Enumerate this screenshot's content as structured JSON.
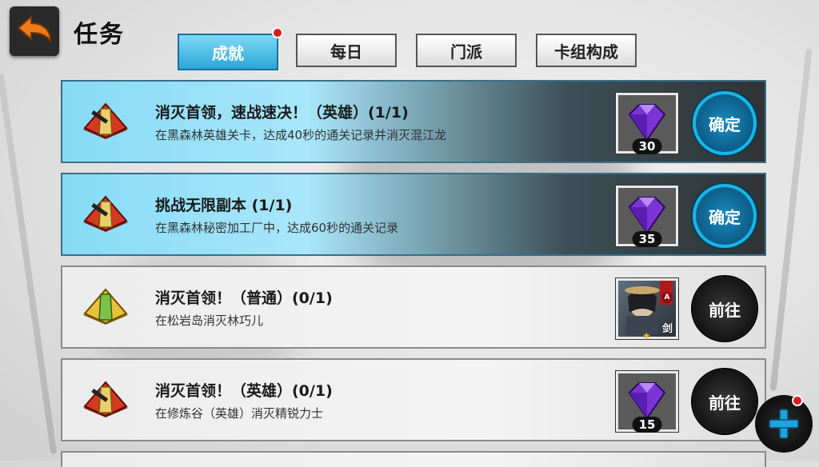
{
  "header": {
    "title": "任务",
    "back_icon": "back-arrow-icon"
  },
  "tabs": [
    {
      "label": "成就",
      "active": true,
      "has_notification": true
    },
    {
      "label": "每日",
      "active": false,
      "has_notification": false
    },
    {
      "label": "门派",
      "active": false,
      "has_notification": false
    },
    {
      "label": "卡组构成",
      "active": false,
      "has_notification": false
    }
  ],
  "tasks": [
    {
      "title": "消灭首领，速战速决！（英雄）(1/1)",
      "description": "在黑森林英雄关卡，达成40秒的通关记录并消灭混江龙",
      "badge_icon": "red-achievement-badge-icon",
      "reward": {
        "icon": "purple-gem-icon",
        "quantity": "30"
      },
      "action": "确定",
      "status": "complete"
    },
    {
      "title": "挑战无限副本 (1/1)",
      "description": "在黑森林秘密加工厂中，达成60秒的通关记录",
      "badge_icon": "red-achievement-badge-icon",
      "reward": {
        "icon": "purple-gem-icon",
        "quantity": "35"
      },
      "action": "确定",
      "status": "complete"
    },
    {
      "title": "消灭首领！（普通）(0/1)",
      "description": "在松岩岛消灭林巧儿",
      "badge_icon": "green-achievement-badge-icon",
      "reward": {
        "icon": "hero-card-icon",
        "rank": "A",
        "class": "剑"
      },
      "action": "前往",
      "status": "pending"
    },
    {
      "title": "消灭首领！（英雄）(0/1)",
      "description": "在修炼谷（英雄）消灭精锐力士",
      "badge_icon": "red-achievement-badge-icon",
      "reward": {
        "icon": "purple-gem-icon",
        "quantity": "15"
      },
      "action": "前往",
      "status": "pending"
    }
  ],
  "fab": {
    "icon": "plus-icon",
    "has_notification": true
  },
  "colors": {
    "tab_active": "#2aa6d6",
    "notification": "#e01919",
    "complete_row": "#86dbf6",
    "confirm_ring": "#17b6e8"
  }
}
